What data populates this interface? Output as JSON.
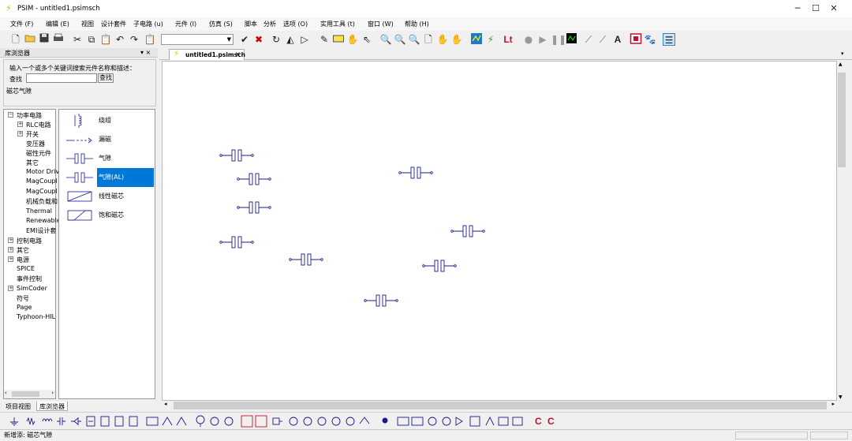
{
  "window": {
    "title": "PSIM - untitled1.psimsch",
    "minimize": "─",
    "maximize": "☐",
    "close": "✕"
  },
  "menu": [
    "文件 (F)",
    "编辑 (E)",
    "视图",
    "设计套件",
    "子电路 (u)",
    "元件 (I)",
    "仿真 (S)",
    "脚本",
    "分析",
    "选项 (O)",
    "实用工具 (t)",
    "窗口 (W)",
    "帮助 (H)"
  ],
  "toolbar_text": {
    "lt": "Lt",
    "text_tool": "A"
  },
  "library": {
    "title": "库浏览器",
    "pin": "▾ ×",
    "search_hint": "输入一个或多个关键词搜索元件名称和描述：",
    "search_label": "查找",
    "search_value": "",
    "search_button": "查找",
    "description": "磁芯气隙",
    "tree": [
      "功率电路",
      "RLC电路",
      "开关",
      "变压器",
      "磁性元件",
      "其它",
      "Motor Driv",
      "MagCoupl",
      "MagCoupl",
      "机械负载和",
      "Thermal",
      "Renewable",
      "EMI设计套",
      "控制电路",
      "其它",
      "电源",
      "SPICE",
      "事件控制",
      "SimCoder",
      "符号",
      "Page",
      "Typhoon-HIL"
    ],
    "elements": [
      "绕组",
      "漏磁",
      "气隙",
      "气隙(AL)",
      "线性磁芯",
      "饱和磁芯"
    ],
    "selected_element": "气隙(AL)"
  },
  "bottom_tabs": [
    "项目视图",
    "库浏览器"
  ],
  "document": {
    "tab_label": "untitled1.psimsch",
    "tab_close": "×",
    "more": "▾"
  },
  "status": {
    "text": "新增添: 磁芯气隙"
  },
  "colors": {
    "accent": "#0078d7",
    "symbol": "#1a1a8c",
    "lt": "#c8102e"
  }
}
